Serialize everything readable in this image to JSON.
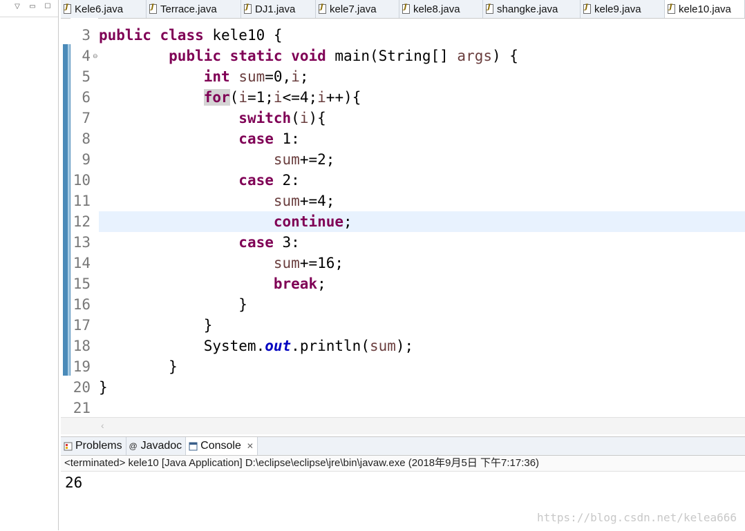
{
  "editor": {
    "tabs": [
      {
        "label": "Kele6.java",
        "active": false
      },
      {
        "label": "Terrace.java",
        "active": false
      },
      {
        "label": "DJ1.java",
        "active": false
      },
      {
        "label": "kele7.java",
        "active": false
      },
      {
        "label": "kele8.java",
        "active": false
      },
      {
        "label": "shangke.java",
        "active": false
      },
      {
        "label": "kele9.java",
        "active": false
      },
      {
        "label": "kele10.java",
        "active": true
      }
    ],
    "line_numbers": [
      "3",
      "4",
      "5",
      "6",
      "7",
      "8",
      "9",
      "10",
      "11",
      "12",
      "13",
      "14",
      "15",
      "16",
      "17",
      "18",
      "19",
      "20",
      "21"
    ],
    "code": {
      "l3": [
        "public",
        " ",
        "class",
        " kele10 {"
      ],
      "l4": [
        "public",
        " ",
        "static",
        " ",
        "void",
        " main(String[] ",
        "args",
        ") {"
      ],
      "l5": [
        "int",
        " ",
        "sum",
        "=0,",
        "i",
        ";"
      ],
      "l6": [
        "for",
        "(",
        "i",
        "=1;",
        "i",
        "<=4;",
        "i",
        "++){"
      ],
      "l7": [
        "switch",
        "(",
        "i",
        "){"
      ],
      "l8": [
        "case",
        " 1:"
      ],
      "l9": [
        "sum",
        "+=2;"
      ],
      "l10": [
        "case",
        " 2:"
      ],
      "l11": [
        "sum",
        "+=4;"
      ],
      "l12": [
        "continue",
        ";"
      ],
      "l13": [
        "case",
        " 3:"
      ],
      "l14": [
        "sum",
        "+=16;"
      ],
      "l15": [
        "break",
        ";"
      ],
      "l16": [
        "}"
      ],
      "l17": [
        "}"
      ],
      "l18": [
        "System.",
        "out",
        ".println(",
        "sum",
        ");"
      ],
      "l19": [
        "}"
      ],
      "l20": [
        "}"
      ]
    }
  },
  "console": {
    "tabs": [
      {
        "label": "Problems",
        "icon": "problems-icon"
      },
      {
        "label": "Javadoc",
        "icon": "javadoc-icon"
      },
      {
        "label": "Console",
        "icon": "console-icon",
        "active": true
      }
    ],
    "status": "<terminated> kele10 [Java Application] D:\\eclipse\\eclipse\\jre\\bin\\javaw.exe (2018年9月5日 下午7:17:36)",
    "output": "26"
  },
  "watermark": "https://blog.csdn.net/kelea666",
  "colors": {
    "keyword": "#7f0055",
    "field": "#0000c0",
    "variable": "#6a3e3e",
    "current_line": "#e8f2fe"
  }
}
